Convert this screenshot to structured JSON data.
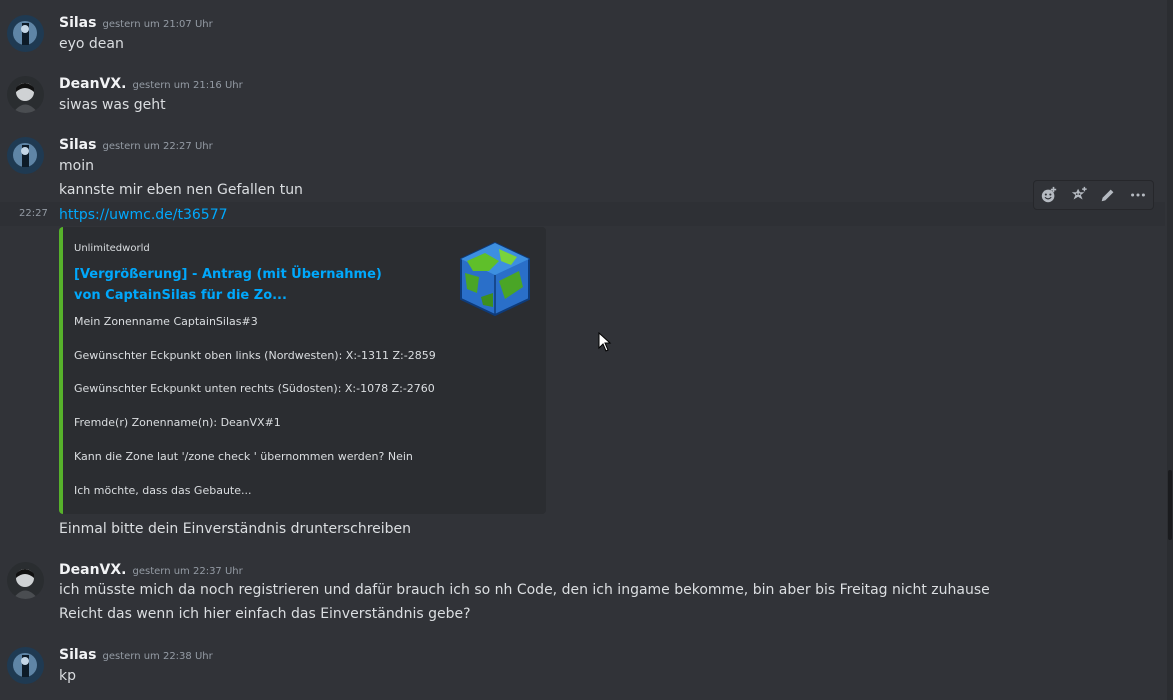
{
  "messages": [
    {
      "author": "Silas",
      "timestamp": "gestern um 21:07 Uhr",
      "lines": [
        "eyo dean"
      ]
    },
    {
      "author": "DeanVX.",
      "timestamp": "gestern um 21:16 Uhr",
      "lines": [
        "siwas was geht"
      ]
    },
    {
      "author": "Silas",
      "timestamp": "gestern um 22:27 Uhr",
      "lines": [
        "moin",
        "kannste mir eben nen Gefallen tun",
        "https://uwmc.de/t36577"
      ],
      "hover_time": "22:27",
      "embed": {
        "provider": "Unlimitedworld",
        "title": "[Vergrößerung] - Antrag (mit Übernahme) von CaptainSilas für die Zo...",
        "description": [
          "Mein Zonenname CaptainSilas#3",
          "Gewünschter Eckpunkt oben links (Nordwesten): X:-1311 Z:-2859",
          "Gewünschter Eckpunkt unten rechts (Südosten): X:-1078 Z:-2760",
          "Fremde(r) Zonenname(n): DeanVX#1",
          "Kann die Zone laut '/zone check ' übernommen werden? Nein",
          "Ich möchte, dass das Gebaute..."
        ],
        "color": "#57b22b"
      },
      "after_embed": "Einmal bitte dein Einverständnis drunterschreiben"
    },
    {
      "author": "DeanVX.",
      "timestamp": "gestern um 22:37 Uhr",
      "lines": [
        "ich müsste mich da noch registrieren und dafür brauch ich so nh Code, den ich ingame bekomme, bin aber bis Freitag nicht zuhause",
        "Reicht das wenn ich hier einfach das Einverständnis gebe?"
      ]
    },
    {
      "author": "Silas",
      "timestamp": "gestern um 22:38 Uhr",
      "lines": [
        "kp"
      ]
    }
  ],
  "toolbar": {
    "icons": [
      "add-reaction-icon",
      "super-reaction-icon",
      "edit-icon",
      "more-icon"
    ]
  },
  "colors": {
    "background": "#313338",
    "link": "#00a8fc",
    "embed_bg": "#2b2d31",
    "timestamp": "#949ba4"
  }
}
